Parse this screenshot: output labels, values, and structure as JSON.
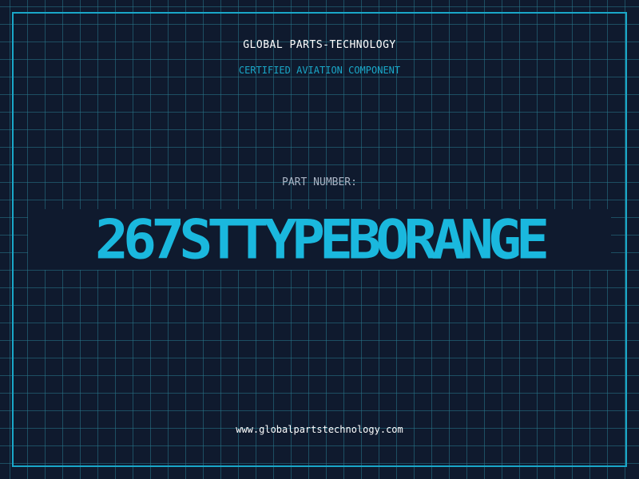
{
  "header": {
    "company_name": "GLOBAL PARTS-TECHNOLOGY",
    "subtitle": "CERTIFIED AVIATION COMPONENT"
  },
  "part": {
    "label": "PART NUMBER:",
    "number": "267STTYPEBORANGE"
  },
  "footer": {
    "url": "www.globalpartstechnology.com"
  },
  "colors": {
    "background": "#0f1a2e",
    "grid": "#28788c",
    "accent": "#1aa7c8",
    "part_number": "#1ab8de",
    "text": "#ffffff",
    "muted_text": "#aab4c4"
  }
}
